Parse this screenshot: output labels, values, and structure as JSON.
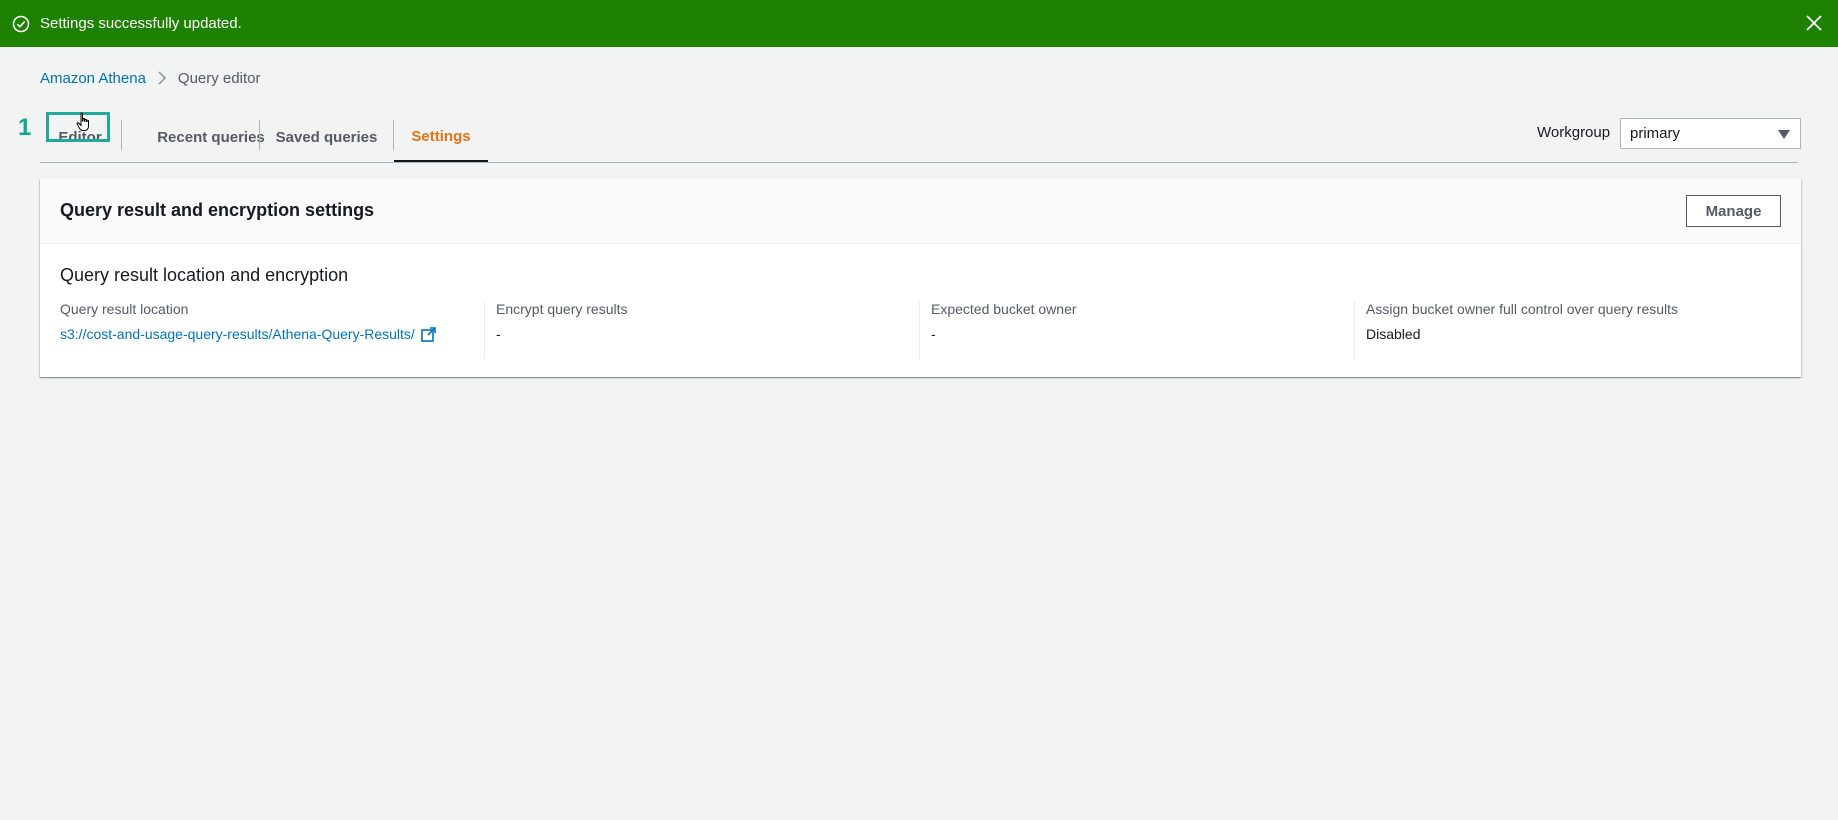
{
  "flash": {
    "message": "Settings successfully updated.",
    "bg_color": "#1d8102"
  },
  "breadcrumb": {
    "root": "Amazon Athena",
    "current": "Query editor"
  },
  "step_marker": "1",
  "tabs": [
    {
      "label": "Editor"
    },
    {
      "label": "Recent queries"
    },
    {
      "label": "Saved queries"
    },
    {
      "label": "Settings",
      "active": true
    }
  ],
  "workgroup": {
    "label": "Workgroup",
    "value": "primary"
  },
  "panel": {
    "title": "Query result and encryption settings",
    "manage_label": "Manage",
    "subtitle": "Query result location and encryption",
    "fields": [
      {
        "label": "Query result location",
        "value": "s3://cost-and-usage-query-results/Athena-Query-Results/"
      },
      {
        "label": "Encrypt query results",
        "value": "-"
      },
      {
        "label": "Expected bucket owner",
        "value": "-"
      },
      {
        "label": "Assign bucket owner full control over query results",
        "value": "Disabled"
      }
    ]
  },
  "colors": {
    "accent": "#ec7211",
    "link": "#0073bb",
    "annotation": "#21a99a"
  }
}
